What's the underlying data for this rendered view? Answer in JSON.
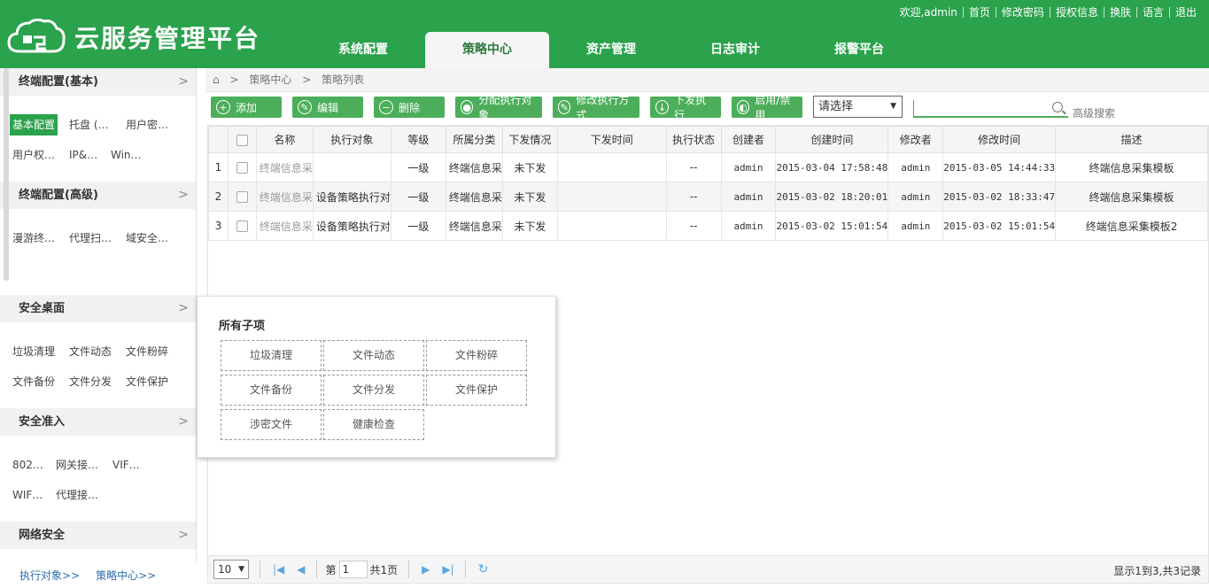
{
  "app": {
    "title": "云服务管理平台"
  },
  "top_links": [
    "欢迎,admin",
    "首页",
    "修改密码",
    "授权信息",
    "换肤",
    "语言",
    "退出"
  ],
  "nav": [
    {
      "label": "系统配置",
      "active": false
    },
    {
      "label": "策略中心",
      "active": true
    },
    {
      "label": "资产管理",
      "active": false
    },
    {
      "label": "日志审计",
      "active": false
    },
    {
      "label": "报警平台",
      "active": false
    }
  ],
  "sidebar": {
    "sections": [
      {
        "title": "终端配置(基本)",
        "items": [
          "基本配置",
          "托盘 (…",
          "用户密…",
          "用户权…",
          "IP&…",
          "Win…"
        ]
      },
      {
        "title": "终端配置(高级)",
        "items": [
          "漫游终…",
          "代理扫…",
          "域安全…"
        ]
      },
      {
        "title": "安全桌面",
        "items": [
          "垃圾清理",
          "文件动态",
          "文件粉碎",
          "文件备份",
          "文件分发",
          "文件保护"
        ]
      },
      {
        "title": "安全准入",
        "items": [
          "802…",
          "网关接…",
          "VIF…",
          "WIF…",
          "代理接…"
        ]
      },
      {
        "title": "网络安全",
        "items": []
      }
    ],
    "footer_links": [
      "执行对象>>",
      "策略中心>>"
    ]
  },
  "breadcrumb": [
    "策略中心",
    "策略列表"
  ],
  "toolbar": {
    "buttons": [
      "添加",
      "编辑",
      "删除",
      "分配执行对象",
      "修改执行方式",
      "下发执行",
      "启用/禁用"
    ],
    "select_value": "请选择",
    "search_placeholder": "",
    "advanced_search": "高级搜索"
  },
  "table": {
    "columns": [
      "",
      "名称",
      "执行对象",
      "等级",
      "所属分类",
      "下发情况",
      "下发时间",
      "执行状态",
      "创建者",
      "创建时间",
      "修改者",
      "修改时间",
      "描述"
    ],
    "rows": [
      {
        "num": "1",
        "name": "终端信息采",
        "target": "",
        "level": "一级",
        "category": "终端信息采",
        "dispatch": "未下发",
        "dispatch_time": "",
        "exec_status": "--",
        "creator": "admin",
        "created": "2015-03-04 17:58:48",
        "modifier": "admin",
        "modified": "2015-03-05 14:44:33",
        "desc": "终端信息采集模板"
      },
      {
        "num": "2",
        "name": "终端信息采",
        "target": "设备策略执行对",
        "level": "一级",
        "category": "终端信息采",
        "dispatch": "未下发",
        "dispatch_time": "",
        "exec_status": "--",
        "creator": "admin",
        "created": "2015-03-02 18:20:01",
        "modifier": "admin",
        "modified": "2015-03-02 18:33:47",
        "desc": "终端信息采集模板"
      },
      {
        "num": "3",
        "name": "终端信息采",
        "target": "设备策略执行对",
        "level": "一级",
        "category": "终端信息采",
        "dispatch": "未下发",
        "dispatch_time": "",
        "exec_status": "--",
        "creator": "admin",
        "created": "2015-03-02 15:01:54",
        "modifier": "admin",
        "modified": "2015-03-02 15:01:54",
        "desc": "终端信息采集模板2"
      }
    ]
  },
  "popup": {
    "title": "所有子项",
    "items": [
      "垃圾清理",
      "文件动态",
      "文件粉碎",
      "文件备份",
      "文件分发",
      "文件保护",
      "涉密文件",
      "健康检查"
    ]
  },
  "pager": {
    "page_size": "10",
    "page_prefix": "第",
    "page": "1",
    "total_pages": "共1页",
    "info": "显示1到3,共3记录"
  },
  "colors": {
    "brand": "#2ba24c",
    "button": "#4cae5a"
  }
}
